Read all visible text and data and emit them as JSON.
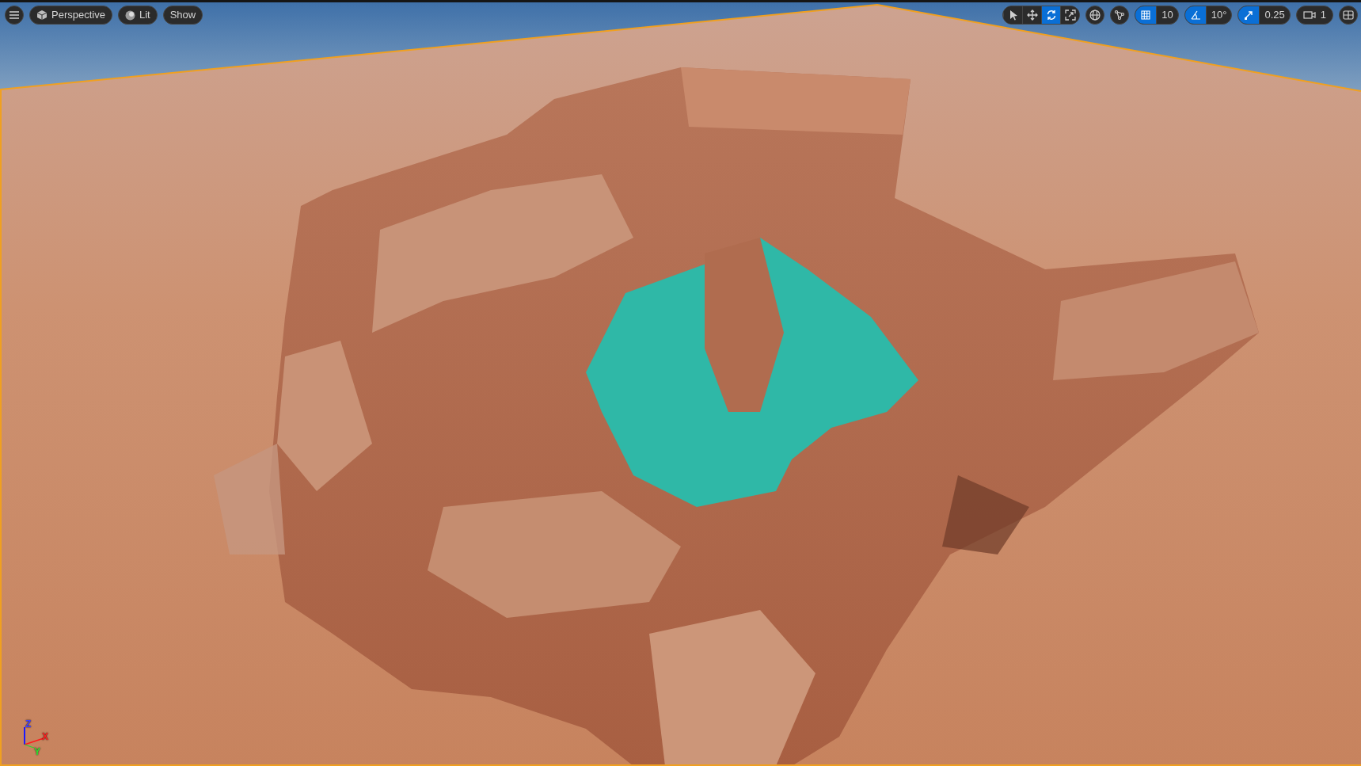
{
  "viewport_toolbar": {
    "view_mode": {
      "label": "Perspective"
    },
    "lighting": {
      "label": "Lit"
    },
    "show": {
      "label": "Show"
    }
  },
  "transform_tools": [
    {
      "kind": "select",
      "selected": false
    },
    {
      "kind": "move",
      "selected": false
    },
    {
      "kind": "rotate",
      "selected": true
    },
    {
      "kind": "scale",
      "selected": false
    }
  ],
  "snaps": [
    {
      "kind": "grid",
      "on": true,
      "value": "10"
    },
    {
      "kind": "angle",
      "on": true,
      "value": "10°"
    },
    {
      "kind": "scale",
      "on": true,
      "value": "0.25"
    }
  ],
  "camera_speed": "1",
  "axis_gizmo": {
    "z": "Z",
    "x": "X",
    "y": "Y"
  }
}
